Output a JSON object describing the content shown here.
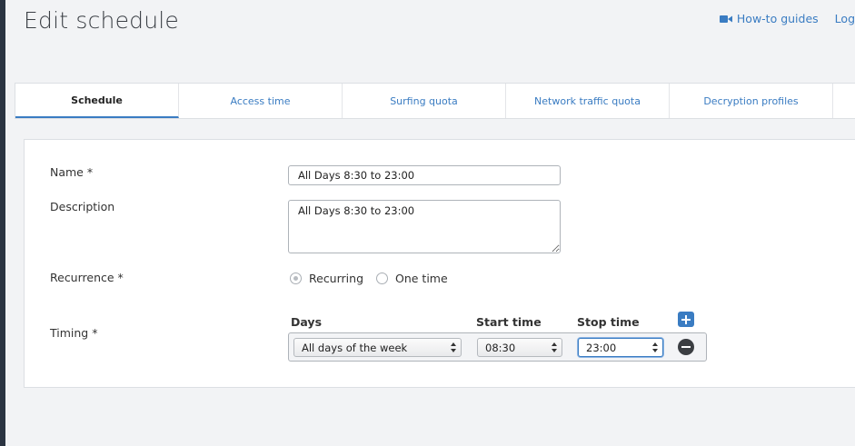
{
  "page": {
    "title": "Edit schedule"
  },
  "header_links": [
    {
      "label": "How-to guides",
      "icon": "video-camera-icon"
    },
    {
      "label": "Log"
    }
  ],
  "tabs": [
    {
      "label": "Schedule",
      "active": true
    },
    {
      "label": "Access time"
    },
    {
      "label": "Surfing quota"
    },
    {
      "label": "Network traffic quota"
    },
    {
      "label": "Decryption profiles"
    }
  ],
  "form": {
    "name": {
      "label": "Name *",
      "value": "All Days 8:30 to 23:00"
    },
    "description": {
      "label": "Description",
      "value": "All Days 8:30 to 23:00"
    },
    "recurrence": {
      "label": "Recurrence *",
      "options": [
        {
          "label": "Recurring",
          "selected": true
        },
        {
          "label": "One time",
          "selected": false
        }
      ]
    },
    "timing": {
      "label": "Timing *",
      "columns": {
        "days": "Days",
        "start": "Start time",
        "stop": "Stop time"
      },
      "row": {
        "days": "All days of the week",
        "start": "08:30",
        "stop": "23:00"
      }
    }
  },
  "colors": {
    "accent": "#3a7cc2",
    "sidebar": "#2b3442",
    "background": "#f2f3f5"
  }
}
